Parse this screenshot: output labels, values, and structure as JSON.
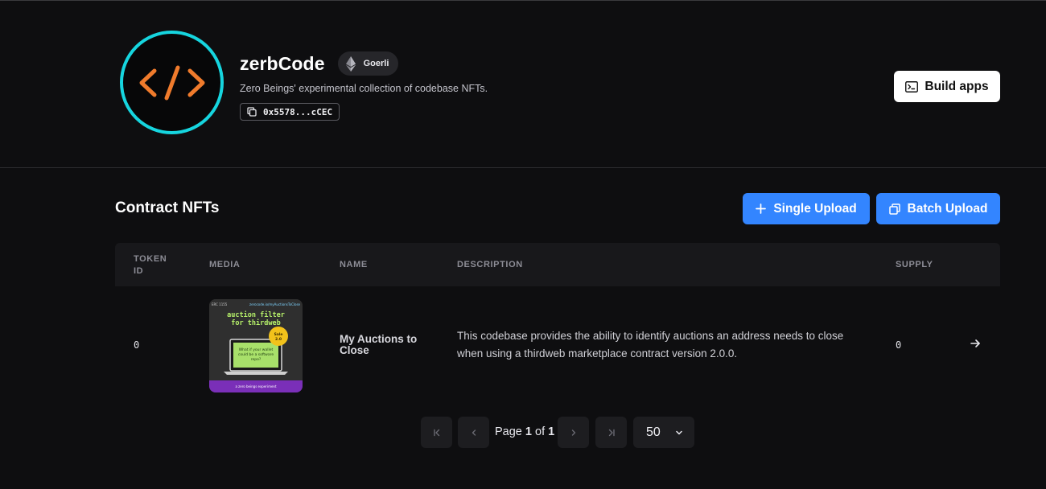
{
  "contract": {
    "name": "zerbCode",
    "network": "Goerli",
    "description": "Zero Beings' experimental collection of codebase NFTs.",
    "address": "0x5578...cCEC",
    "avatar_text": "</>"
  },
  "header": {
    "build_button": "Build apps"
  },
  "section": {
    "title": "Contract NFTs",
    "single_upload": "Single Upload",
    "batch_upload": "Batch Upload"
  },
  "table": {
    "columns": [
      "TOKEN ID",
      "MEDIA",
      "NAME",
      "DESCRIPTION",
      "SUPPLY"
    ],
    "rows": [
      {
        "token_id": "0",
        "name": "My Auctions to Close",
        "description": "This codebase provides the ability to identify auctions an address needs to close when using a thirdweb marketplace contract version 2.0.0.",
        "supply": "0",
        "media": {
          "tag_left": "ERC 1155",
          "tag_right": "zerocode.io/myAuctionsToClose",
          "headline": "auction filter for thirdweb",
          "badge": "Sale 2.0",
          "screen_text": "What if your wallet could be a software repo?",
          "footer": "a zero beings experiment"
        }
      }
    ]
  },
  "pagination": {
    "page_label": "Page",
    "current_page": "1",
    "of_label": "of",
    "total_pages": "1",
    "page_size": "50"
  },
  "colors": {
    "background": "#0e0e10",
    "accent": "#3385ff",
    "avatar_ring": "#16d5df",
    "avatar_glyph": "#f07b2c"
  }
}
